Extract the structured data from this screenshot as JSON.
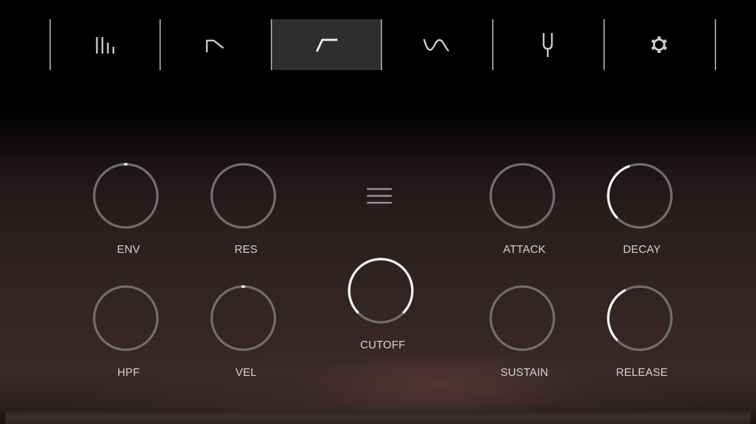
{
  "tabs": [
    {
      "icon": "mixer-icon",
      "active": false
    },
    {
      "icon": "lowpass-curve-icon",
      "active": false
    },
    {
      "icon": "filter-envelope-icon",
      "active": true
    },
    {
      "icon": "lfo-wave-icon",
      "active": false
    },
    {
      "icon": "tuning-fork-icon",
      "active": false
    },
    {
      "icon": "gear-icon",
      "active": false
    }
  ],
  "menu": {
    "icon": "hamburger-menu-icon"
  },
  "knobs": {
    "env": {
      "label": "ENV",
      "value": 0.5
    },
    "res": {
      "label": "RES",
      "value": 0.0
    },
    "hpf": {
      "label": "HPF",
      "value": 0.0
    },
    "vel": {
      "label": "VEL",
      "value": 0.5
    },
    "cutoff": {
      "label": "CUTOFF",
      "value": 1.0
    },
    "attack": {
      "label": "ATTACK",
      "value": 0.0
    },
    "decay": {
      "label": "DECAY",
      "value": 0.43
    },
    "sustain": {
      "label": "SUSTAIN",
      "value": 0.0
    },
    "release": {
      "label": "RELEASE",
      "value": 0.4
    }
  },
  "colors": {
    "track": "#6e6e6e",
    "arc": "#f2f2f2",
    "label": "#d4d4d4",
    "active_tab": "#2e2e2e"
  }
}
